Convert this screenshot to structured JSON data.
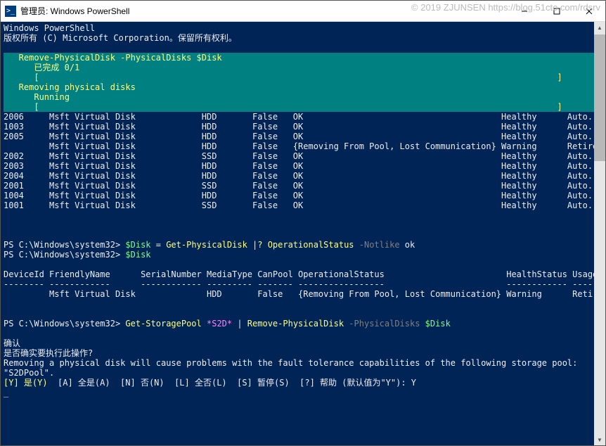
{
  "window": {
    "icon_glyph": ">_",
    "title": "管理员: Windows PowerShell",
    "watermark": "© 2019 ZJUNSEN https://blog.51cto.com/rdsrv"
  },
  "header": {
    "line1": "Windows PowerShell",
    "line2": "版权所有 (C) Microsoft Corporation。保留所有权利。"
  },
  "progress": {
    "line1": "   Remove-PhysicalDisk -PhysicalDisks $Disk",
    "line2": "      已完成 0/1",
    "line3": "      [                                                                                                      ]",
    "line4": "   Removing physical disks",
    "line5": "      Running",
    "line6": "      [                                                                                                      ]"
  },
  "disk_table": {
    "rows": [
      {
        "id": "2006",
        "name": "Msft Virtual Disk",
        "type": "HDD",
        "canpool": "False",
        "status": "OK",
        "health": "Healthy",
        "usage": "Auto..."
      },
      {
        "id": "1003",
        "name": "Msft Virtual Disk",
        "type": "HDD",
        "canpool": "False",
        "status": "OK",
        "health": "Healthy",
        "usage": "Auto..."
      },
      {
        "id": "2005",
        "name": "Msft Virtual Disk",
        "type": "HDD",
        "canpool": "False",
        "status": "OK",
        "health": "Healthy",
        "usage": "Auto..."
      },
      {
        "id": "",
        "name": "Msft Virtual Disk",
        "type": "HDD",
        "canpool": "False",
        "status": "{Removing From Pool, Lost Communication}",
        "health": "Warning",
        "usage": "Retired"
      },
      {
        "id": "2002",
        "name": "Msft Virtual Disk",
        "type": "SSD",
        "canpool": "False",
        "status": "OK",
        "health": "Healthy",
        "usage": "Auto..."
      },
      {
        "id": "2003",
        "name": "Msft Virtual Disk",
        "type": "HDD",
        "canpool": "False",
        "status": "OK",
        "health": "Healthy",
        "usage": "Auto..."
      },
      {
        "id": "2004",
        "name": "Msft Virtual Disk",
        "type": "HDD",
        "canpool": "False",
        "status": "OK",
        "health": "Healthy",
        "usage": "Auto..."
      },
      {
        "id": "2001",
        "name": "Msft Virtual Disk",
        "type": "SSD",
        "canpool": "False",
        "status": "OK",
        "health": "Healthy",
        "usage": "Auto..."
      },
      {
        "id": "1004",
        "name": "Msft Virtual Disk",
        "type": "HDD",
        "canpool": "False",
        "status": "OK",
        "health": "Healthy",
        "usage": "Auto..."
      },
      {
        "id": "1001",
        "name": "Msft Virtual Disk",
        "type": "SSD",
        "canpool": "False",
        "status": "OK",
        "health": "Healthy",
        "usage": "Auto..."
      }
    ]
  },
  "cmd1": {
    "prompt": "PS C:\\Windows\\system32> ",
    "var": "$Disk",
    "eq": " = ",
    "cmdlet": "Get-PhysicalDisk",
    "pipe": " |",
    "where": "? OperationalStatus ",
    "op": "-Notlike",
    "arg": " ok"
  },
  "cmd2": {
    "prompt": "PS C:\\Windows\\system32> ",
    "var": "$Disk"
  },
  "result_table": {
    "hdr": "DeviceId FriendlyName      SerialNumber MediaType CanPool OperationalStatus                        HealthStatus Usage",
    "sep": "-------- ------------      ------------ --------- ------- -----------------                        ------------ -----",
    "row": "         Msft Virtual Disk              HDD       False   {Removing From Pool, Lost Communication} Warning      Retired"
  },
  "cmd3": {
    "prompt": "PS C:\\Windows\\system32> ",
    "cmdlet1": "Get-StoragePool",
    "arg1": " *S2D* ",
    "pipe": "|",
    "cmdlet2": " Remove-PhysicalDisk ",
    "param": "-PhysicalDisks ",
    "var": "$Disk"
  },
  "confirm": {
    "title": "确认",
    "question": "是否确实要执行此操作?",
    "msg1": "Removing a physical disk will cause problems with the fault tolerance capabilities of the following storage pool:",
    "msg2": "\"S2DPool\".",
    "yes_key": "[Y] 是(Y)",
    "options": "  [A] 全是(A)  [N] 否(N)  [L] 全否(L)  [S] 暂停(S)  [?] 帮助 (默认值为\"Y\"): Y",
    "cursor": "_"
  }
}
